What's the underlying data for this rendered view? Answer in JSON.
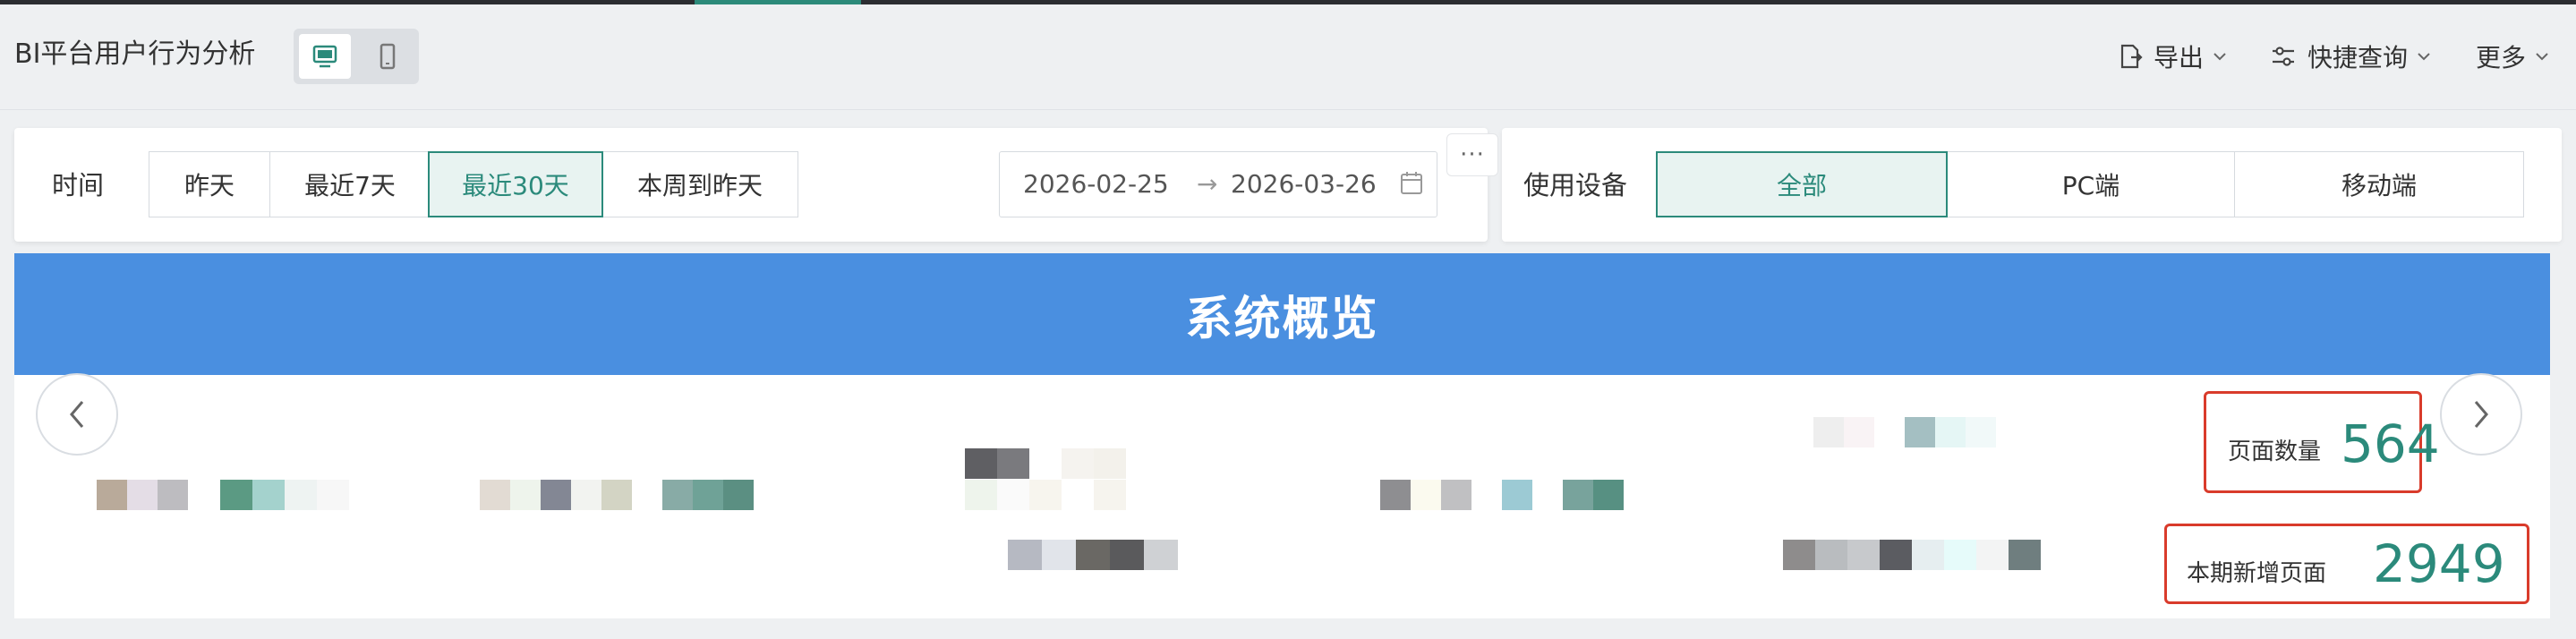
{
  "header": {
    "title": "BI平台用户行为分析",
    "view_toggle": {
      "desktop_icon": "monitor-icon",
      "mobile_icon": "phone-icon",
      "selected": "desktop"
    },
    "actions": [
      {
        "label": "导出",
        "icon": "export-icon"
      },
      {
        "label": "快捷查询",
        "icon": "sliders-icon"
      },
      {
        "label": "更多"
      }
    ]
  },
  "filters": {
    "time_label": "时间",
    "time_options": [
      "昨天",
      "最近7天",
      "最近30天",
      "本周到昨天"
    ],
    "time_selected": "最近30天",
    "date_start": "2026-02-25",
    "date_arrow": "→",
    "date_end": "2026-03-26",
    "more_label": "···",
    "device_label": "使用设备",
    "device_options": [
      "全部",
      "PC端",
      "移动端"
    ],
    "device_selected": "全部"
  },
  "overview": {
    "title": "系统概览",
    "stats": [
      {
        "label": "页面数量",
        "value": "564"
      },
      {
        "label": "本期新增页面",
        "value": "2949"
      }
    ],
    "accent_color": "#4a8fe0",
    "value_color": "#2b8a7b",
    "highlight_color": "#d93b2b"
  }
}
